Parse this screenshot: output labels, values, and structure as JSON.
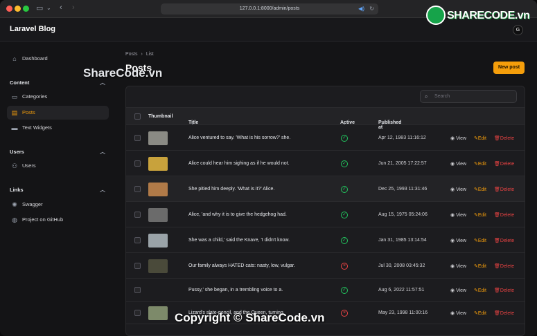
{
  "browser": {
    "url": "127.0.0.1:8000/admin/posts"
  },
  "watermark": {
    "top_brand": "SHARECODE.vn",
    "overlay": "ShareCode.vn",
    "footer": "Copyright © ShareCode.vn"
  },
  "app": {
    "brand": "Laravel Blog",
    "avatar_initial": "G"
  },
  "sidebar": {
    "dashboard": "Dashboard",
    "content_group": "Content",
    "categories": "Categories",
    "posts": "Posts",
    "text_widgets": "Text Widgets",
    "users_group": "Users",
    "users": "Users",
    "links_group": "Links",
    "swagger": "Swagger",
    "github": "Project on GitHub"
  },
  "breadcrumb": {
    "root": "Posts",
    "current": "List"
  },
  "page": {
    "title": "Posts",
    "new_button": "New post",
    "search_placeholder": "Search"
  },
  "table": {
    "columns": {
      "thumbnail": "Thumbnail",
      "title": "Title",
      "active": "Active",
      "published_at": "Published at"
    },
    "actions": {
      "view": "View",
      "edit": "Edit",
      "delete": "Delete"
    },
    "rows": [
      {
        "title": "Alice ventured to say. 'What is his sorrow?' she.",
        "active": true,
        "published_at": "Apr 12, 1983 11:16:12",
        "thumb_color": "#8a8a84"
      },
      {
        "title": "Alice could hear him sighing as if he would not.",
        "active": true,
        "published_at": "Jun 21, 2005 17:22:57",
        "thumb_color": "#c8a23c"
      },
      {
        "title": "She pitied him deeply. 'What is it?' Alice.",
        "active": true,
        "published_at": "Dec 25, 1993 11:31:46",
        "thumb_color": "#b07a48"
      },
      {
        "title": "Alice, 'and why it is to give the hedgehog had.",
        "active": true,
        "published_at": "Aug 15, 1975 05:24:06",
        "thumb_color": "#6b6b6b"
      },
      {
        "title": "She was a child,' said the Knave, 'I didn't know.",
        "active": true,
        "published_at": "Jan 31, 1985 13:14:54",
        "thumb_color": "#9aa3a8"
      },
      {
        "title": "Our family always HATED cats: nasty, low, vulgar.",
        "active": false,
        "published_at": "Jul 30, 2008 03:45:32",
        "thumb_color": "#4a4a3a"
      },
      {
        "title": "Pussy,' she began, in a trembling voice to a.",
        "active": true,
        "published_at": "Aug 6, 2022 11:57:51",
        "thumb_color": ""
      },
      {
        "title": "Lizard's slate-pencil, and the Queen, turning.",
        "active": false,
        "published_at": "May 23, 1998 11:00:16",
        "thumb_color": "#7d8a6a"
      }
    ]
  }
}
